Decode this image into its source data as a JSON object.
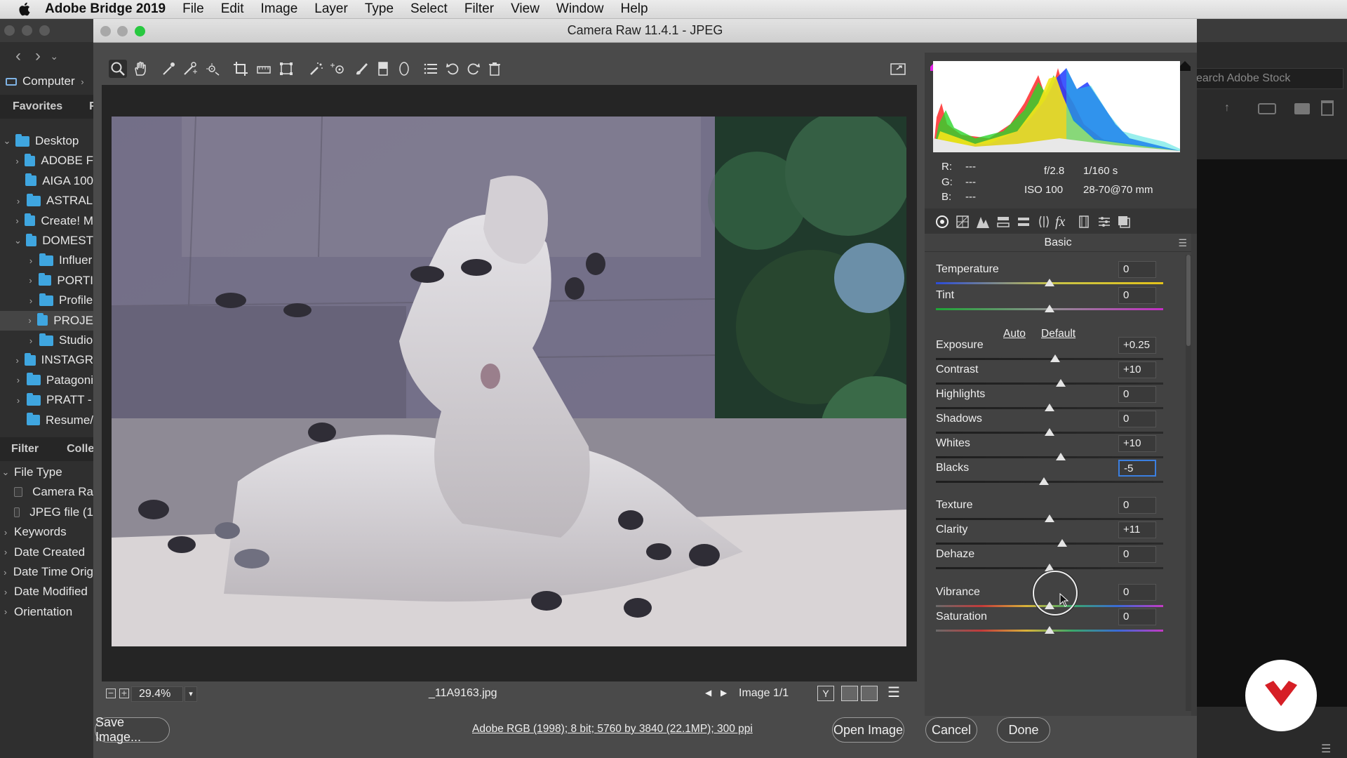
{
  "menubar": {
    "app": "Adobe Bridge 2019",
    "items": [
      "File",
      "Edit",
      "Image",
      "Layer",
      "Type",
      "Select",
      "Filter",
      "View",
      "Window",
      "Help"
    ]
  },
  "bridge": {
    "path": "Computer",
    "search_placeholder": "earch Adobe Stock",
    "favorites_tab": "Favorites",
    "folders_tab": "F",
    "tree": [
      {
        "label": "Desktop",
        "expanded": true
      },
      {
        "label": "ADOBE F"
      },
      {
        "label": "AIGA 100"
      },
      {
        "label": "ASTRAL"
      },
      {
        "label": "Create! M"
      },
      {
        "label": "DOMEST",
        "expanded": true
      },
      {
        "label": "Influer"
      },
      {
        "label": "PORTI"
      },
      {
        "label": "Profile"
      },
      {
        "label": "PROJE"
      },
      {
        "label": "Studio"
      },
      {
        "label": "INSTAGR"
      },
      {
        "label": "Patagoni"
      },
      {
        "label": "PRATT -"
      },
      {
        "label": "Resume/"
      }
    ],
    "filter_tab": "Filter",
    "collections_tab": "Colle",
    "filters": [
      {
        "label": "File Type",
        "expanded": true
      },
      {
        "label": "Camera Ra",
        "checkbox": true
      },
      {
        "label": "JPEG file (1",
        "checkbox": true
      },
      {
        "label": "Keywords"
      },
      {
        "label": "Date Created"
      },
      {
        "label": "Date Time Orig"
      },
      {
        "label": "Date Modified"
      },
      {
        "label": "Orientation"
      }
    ]
  },
  "dialog": {
    "title": "Camera Raw 11.4.1  -  JPEG",
    "zoom": "29.4%",
    "filename": "_11A9163.jpg",
    "image_counter": "Image 1/1",
    "image_info": "Adobe RGB (1998); 8 bit; 5760 by 3840 (22.1MP); 300 ppi",
    "buttons": {
      "save": "Save Image...",
      "open": "Open Image",
      "cancel": "Cancel",
      "done": "Done"
    },
    "readout": {
      "r": "R:",
      "g": "G:",
      "b": "B:",
      "rv": "---",
      "gv": "---",
      "bv": "---",
      "aperture": "f/2.8",
      "shutter": "1/160 s",
      "iso": "ISO 100",
      "lens": "28-70@70 mm"
    },
    "panel_title": "Basic",
    "auto": "Auto",
    "default": "Default",
    "sliders": [
      {
        "label": "Temperature",
        "value": "0",
        "pos": 0.5,
        "gradient": "temp"
      },
      {
        "label": "Tint",
        "value": "0",
        "pos": 0.5,
        "gradient": "tint"
      },
      {
        "label": "Exposure",
        "value": "+0.25",
        "pos": 0.525
      },
      {
        "label": "Contrast",
        "value": "+10",
        "pos": 0.55
      },
      {
        "label": "Highlights",
        "value": "0",
        "pos": 0.5
      },
      {
        "label": "Shadows",
        "value": "0",
        "pos": 0.5
      },
      {
        "label": "Whites",
        "value": "+10",
        "pos": 0.55
      },
      {
        "label": "Blacks",
        "value": "-5",
        "pos": 0.475,
        "active": true
      },
      {
        "label": "Texture",
        "value": "0",
        "pos": 0.5
      },
      {
        "label": "Clarity",
        "value": "+11",
        "pos": 0.555
      },
      {
        "label": "Dehaze",
        "value": "0",
        "pos": 0.5
      },
      {
        "label": "Vibrance",
        "value": "0",
        "pos": 0.5,
        "gradient": "vib"
      },
      {
        "label": "Saturation",
        "value": "0",
        "pos": 0.5,
        "gradient": "sat"
      }
    ]
  }
}
